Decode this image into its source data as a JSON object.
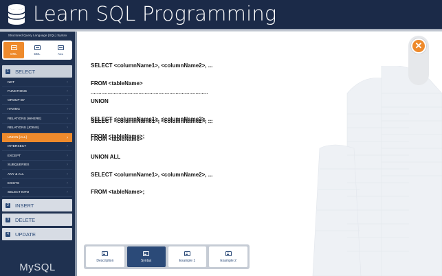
{
  "header": {
    "title": "Learn SQL Programming"
  },
  "sidebar": {
    "caption": "Structured Query Language (SQL) Syntax",
    "mode_tabs": [
      {
        "label": "DML",
        "active": true
      },
      {
        "label": "DDL",
        "active": false
      },
      {
        "label": "ALL",
        "active": false
      }
    ],
    "sections": [
      {
        "num": "1",
        "label": "SELECT"
      },
      {
        "num": "2",
        "label": "INSERT"
      },
      {
        "num": "3",
        "label": "DELETE"
      },
      {
        "num": "4",
        "label": "UPDATE"
      }
    ],
    "select_items": [
      "NOT",
      "FUNCTIONS",
      "GROUP BY",
      "HAVING",
      "RELATIONS (WHERE)",
      "RELATIONS (JOINS)",
      "UNION [ALL]",
      "INTERSECT",
      "EXCEPT",
      "SUBQUERIES",
      "ANY  &  ALL",
      "EXISTS",
      "SELECT INTO"
    ],
    "active_item": "UNION [ALL]",
    "brand": "MySQL"
  },
  "code": {
    "block1": [
      "SELECT <columnName1>, <columnName2>, ...",
      "FROM <tableName>",
      "UNION",
      "SELECT <columnName1>, <columnName2>, ...",
      "FROM <tableName>;"
    ],
    "separator": "............................................................................",
    "block2": [
      "SELECT <columnName1>, <columnName2>, ...",
      "FROM <tableName>",
      "UNION ALL",
      "SELECT <columnName1>, <columnName2>, ...",
      "FROM <tableName>;"
    ]
  },
  "toolbar": {
    "buttons": [
      {
        "label": "Description",
        "icon": "search-doc-icon"
      },
      {
        "label": "Syntax",
        "icon": "list-icon"
      },
      {
        "label": "Example 1",
        "icon": "table-doc-icon"
      },
      {
        "label": "Example 2",
        "icon": "table-doc-icon"
      }
    ],
    "active": "Syntax"
  },
  "close_glyph": "✕",
  "colors": {
    "accent": "#ee8a2c",
    "navy": "#1b2a48",
    "brand_blue": "#2b4a78"
  }
}
